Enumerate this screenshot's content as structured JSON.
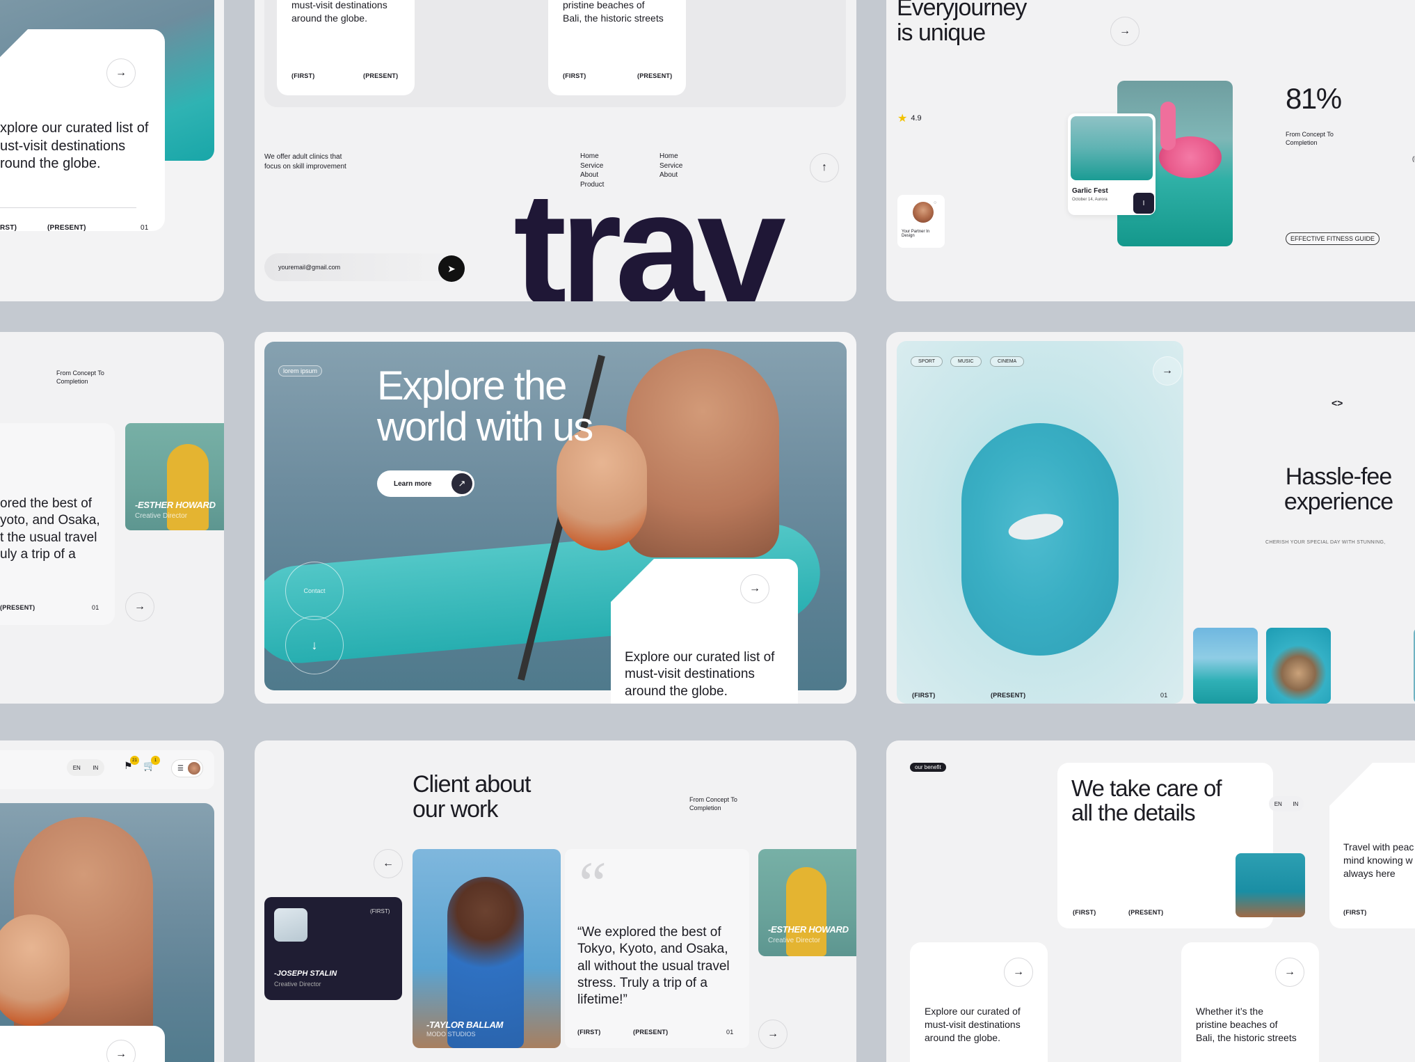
{
  "colors": {
    "background": "#c4c9d0",
    "card": "#f2f2f3",
    "dark": "#1f1d33",
    "accent": "#f2c200"
  },
  "c1": {
    "text": "xplore our curated list of\nust-visit destinations\nround the globe.",
    "first": "RST)",
    "present": "(PRESENT)",
    "num": "01"
  },
  "c2": {
    "left_card": {
      "text": "must-visit destinations\naround the globe.",
      "first": "(FIRST)",
      "present": "(PRESENT)"
    },
    "right_card": {
      "text": "pristine beaches of\nBali, the historic streets",
      "first": "(FIRST)",
      "present": "(PRESENT)"
    },
    "offer": "We offer adult clinics that\nfocus on skill improvement",
    "menu1": [
      "Home",
      "Service",
      "About",
      "Product"
    ],
    "menu2": [
      "Home",
      "Service",
      "About"
    ],
    "email_placeholder": "youremail@gmail.com",
    "brand": "trav"
  },
  "c3": {
    "heading": "Everyjourney\nis unique",
    "rating": "4.9",
    "percent": "81%",
    "percent_label": "From Concept To\nCompletion",
    "event_title": "Garlic Fest",
    "event_date": "October 14, Aurora",
    "partner": "Your Partner In\nDesign",
    "badge": "EFFECTIVE FITNESS GUIDE",
    "edge": "(F"
  },
  "c4": {
    "label": "From Concept To\nCompletion",
    "text": "ored the best of\nyoto, and Osaka,\nt the usual travel\nuly a trip of a",
    "present": "(PRESENT)",
    "num": "01",
    "person_name": "-ESTHER HOWARD",
    "person_role": "Creative Director"
  },
  "c5": {
    "tag": "lorem ipsum",
    "title": "Explore the\nworld with us",
    "cta": "Learn more",
    "contact": "Contact",
    "card_text": "Explore our curated list of\nmust-visit destinations\naround the globe."
  },
  "c6": {
    "tags": [
      "SPORT",
      "MUSIC",
      "CINEMA"
    ],
    "first": "(FIRST)",
    "present": "(PRESENT)",
    "num": "01",
    "title": "Hassle-fee\nexperience",
    "subtitle": "CHERISH YOUR SPECIAL DAY WITH STUNNING,",
    "code_icon": "<>"
  },
  "c7": {
    "lang": [
      "EN",
      "IN"
    ],
    "badge1": "21",
    "badge2": "1"
  },
  "c8": {
    "title": "Client about\nour work",
    "label": "From Concept To\nCompletion",
    "dark_first": "(FIRST)",
    "dark_name": "-JOSEPH STALIN",
    "dark_role": "Creative Director",
    "photo_name": "-TAYLOR BALLAM",
    "photo_role": "MODO STUDIOS",
    "quote": "“We explored the best of\nTokyo, Kyoto, and Osaka,\nall without the usual travel\nstress. Truly a trip of a\nlifetime!”",
    "first": "(FIRST)",
    "present": "(PRESENT)",
    "num": "01",
    "right_name": "-ESTHER HOWARD",
    "right_role": "Creative Director"
  },
  "c9": {
    "tag": "our benefit",
    "title": "We take care of\nall the details",
    "lang": [
      "EN",
      "IN"
    ],
    "first": "(FIRST)",
    "present": "(PRESENT)",
    "side_text": "Travel with peac\nmind knowing w\nalways here",
    "side_first": "(FIRST)",
    "card_a": "Explore our curated of\nmust-visit destinations\naround the globe.",
    "card_b": "Whether it’s the\npristine beaches of\nBali, the historic streets"
  }
}
